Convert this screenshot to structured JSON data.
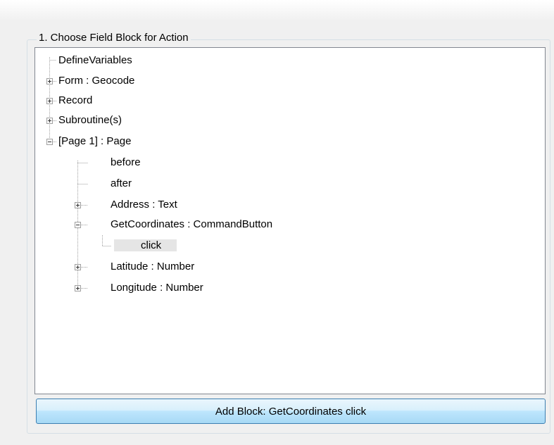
{
  "group": {
    "title": "1. Choose Field Block for Action"
  },
  "tree": {
    "nodes": [
      {
        "label": "DefineVariables",
        "expander": "none"
      },
      {
        "label": "Form : Geocode",
        "expander": "plus"
      },
      {
        "label": "Record",
        "expander": "plus"
      },
      {
        "label": "Subroutine(s)",
        "expander": "plus"
      },
      {
        "label": "[Page 1] : Page",
        "expander": "minus"
      },
      {
        "label": "before",
        "expander": "none"
      },
      {
        "label": "after",
        "expander": "none"
      },
      {
        "label": "Address : Text",
        "expander": "plus"
      },
      {
        "label": "GetCoordinates : CommandButton",
        "expander": "minus"
      },
      {
        "label": "click",
        "expander": "none",
        "selected": true
      },
      {
        "label": "Latitude : Number",
        "expander": "plus"
      },
      {
        "label": "Longitude : Number",
        "expander": "plus"
      }
    ]
  },
  "add_button": {
    "label": "Add Block: GetCoordinates click"
  }
}
